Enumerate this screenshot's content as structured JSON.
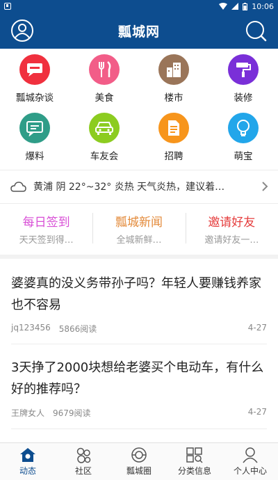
{
  "status_bar": {
    "time": "10:06"
  },
  "header": {
    "title": "瓢城网",
    "user_icon": "user-icon",
    "search_icon": "search-icon"
  },
  "quick_grid": [
    {
      "label": "瓢城杂谈",
      "icon": "chat-icon",
      "color": "#f0303e"
    },
    {
      "label": "美食",
      "icon": "fork-knife-icon",
      "color": "#f25d88"
    },
    {
      "label": "楼市",
      "icon": "building-icon",
      "color": "#9a7559"
    },
    {
      "label": "装修",
      "icon": "paint-roller-icon",
      "color": "#7a2fd8"
    },
    {
      "label": "爆料",
      "icon": "message-icon",
      "color": "#2f9d88"
    },
    {
      "label": "车友会",
      "icon": "car-icon",
      "color": "#8ccc20"
    },
    {
      "label": "招聘",
      "icon": "document-icon",
      "color": "#f7951c"
    },
    {
      "label": "萌宝",
      "icon": "bulb-icon",
      "color": "#22a6ea"
    }
  ],
  "weather": {
    "text": "黄浦 阴 22°~32° 炎热 天气炎热，建议着…",
    "icon": "cloud-icon"
  },
  "features": [
    {
      "title": "每日签到",
      "subtitle": "天天签到得…",
      "color": "#d84fd6"
    },
    {
      "title": "瓢城新闻",
      "subtitle": "全城新鲜…",
      "color": "#e38a3a"
    },
    {
      "title": "邀请好友",
      "subtitle": "邀请好友一…",
      "color": "#e53d3d"
    }
  ],
  "articles": [
    {
      "title": "婆婆真的没义务带孙子吗？年轻人要赚钱养家也不容易",
      "author": "jq123456",
      "views": "5866阅读",
      "date": "4-27"
    },
    {
      "title": "3天挣了2000块想给老婆买个电动车，有什么好的推荐吗？",
      "author": "王牌女人",
      "views": "9679阅读",
      "date": "4-27"
    }
  ],
  "tabs": [
    {
      "label": "动态",
      "icon": "home-icon",
      "active": true
    },
    {
      "label": "社区",
      "icon": "community-icon",
      "active": false
    },
    {
      "label": "瓢城圈",
      "icon": "circle-icon",
      "active": false
    },
    {
      "label": "分类信息",
      "icon": "category-icon",
      "active": false
    },
    {
      "label": "个人中心",
      "icon": "profile-icon",
      "active": false
    }
  ],
  "colors": {
    "primary": "#0d4d8f",
    "text": "#222222",
    "muted": "#888888"
  }
}
